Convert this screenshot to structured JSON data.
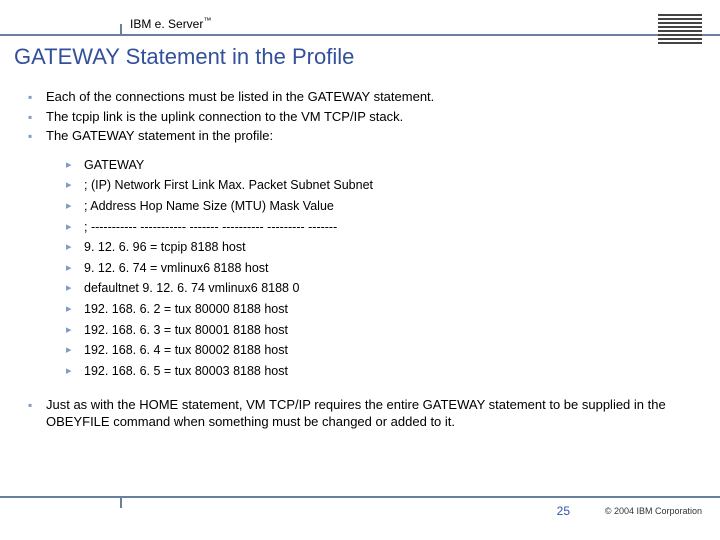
{
  "header": {
    "brand": "IBM e. Server",
    "trademark": "™"
  },
  "title": "GATEWAY Statement in the Profile",
  "intro_bullets": [
    "Each of the connections must be listed in the GATEWAY statement.",
    "The tcpip link is the uplink connection to the VM TCP/IP stack.",
    "The GATEWAY statement in the profile:"
  ],
  "gateway_lines": [
    "GATEWAY",
    "; (IP) Network First Link Max. Packet Subnet Subnet",
    "; Address Hop Name Size (MTU) Mask Value",
    "; ----------- ----------- ------- ---------- --------- -------",
    "9. 12. 6. 96 = tcpip 8188 host",
    "9. 12. 6. 74 = vmlinux6 8188 host",
    "defaultnet 9. 12. 6. 74 vmlinux6 8188 0",
    "192. 168. 6. 2 = tux 80000 8188 host",
    "192. 168. 6. 3 = tux 80001 8188 host",
    "192. 168. 6. 4 = tux 80002 8188 host",
    "192. 168. 6. 5 = tux 80003 8188 host"
  ],
  "outro_bullets": [
    "Just as with the HOME statement, VM TCP/IP requires the entire GATEWAY statement to be supplied in the OBEYFILE command when something must be changed or added to it."
  ],
  "footer": {
    "page": "25",
    "copyright": "© 2004 IBM Corporation"
  }
}
